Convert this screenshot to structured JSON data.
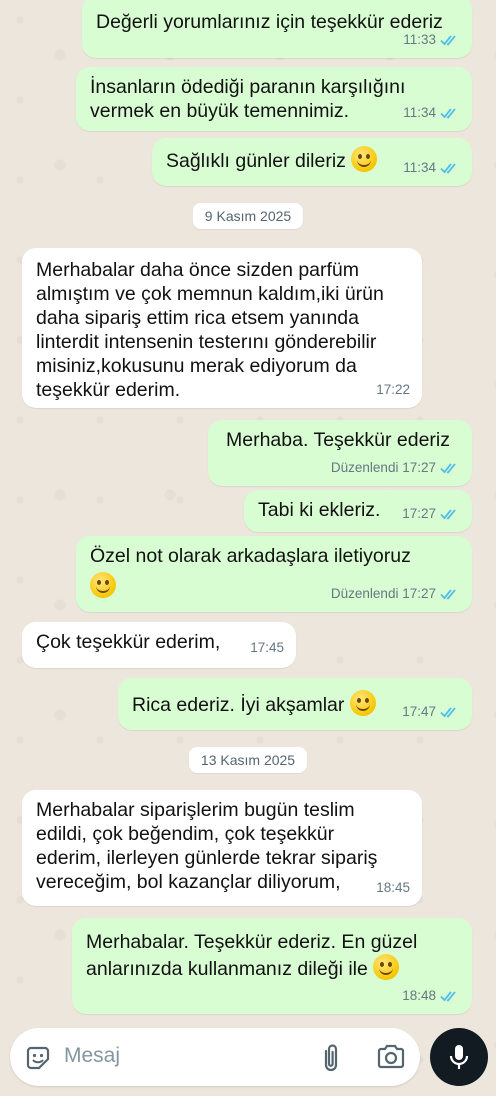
{
  "messages": [
    {
      "text": "Değerli yorumlarınız için teşekkür ederiz",
      "time": "11:33"
    },
    {
      "text": "İnsanların ödediği paranın karşılığını\nvermek en büyük temennimiz.",
      "time": "11:34"
    },
    {
      "text": "Sağlıklı günler dileriz",
      "time": "11:34"
    },
    {
      "text": "Merhabalar daha önce sizden parfüm\nalmıştım ve çok memnun kaldım,iki ürün\ndaha sipariş ettim rica etsem yanında\nlinterdit intensenin testerını gönderebilir\nmisiniz,kokusunu merak ediyorum da\nteşekkür ederim.",
      "time": "17:22"
    },
    {
      "text": "Merhaba. Teşekkür ederiz",
      "time": "Düzenlendi 17:27"
    },
    {
      "text": "Tabi ki ekleriz.",
      "time": "17:27"
    },
    {
      "text": "Özel not olarak arkadaşlara iletiyoruz",
      "time": "Düzenlendi 17:27"
    },
    {
      "text": "Çok teşekkür ederim,",
      "time": "17:45"
    },
    {
      "text": "Rica ederiz. İyi akşamlar",
      "time": "17:47"
    },
    {
      "text": "Merhabalar siparişlerim bugün teslim\nedildi, çok beğendim, çok teşekkür\nederim, ilerleyen günlerde tekrar sipariş\nvereceğim, bol kazançlar diliyorum,",
      "time": "18:45"
    },
    {
      "text": "Merhabalar. Teşekkür ederiz. En güzel\nanlarınızda kullanmanız dileği ile",
      "time": "18:48"
    }
  ],
  "dates": [
    "9 Kasım 2025",
    "13 Kasım 2025"
  ],
  "input": {
    "placeholder": "Mesaj"
  },
  "icons": {
    "emoji_button": "sticker-smile-icon",
    "attach": "paperclip-icon",
    "camera": "camera-icon",
    "mic": "microphone-icon",
    "read_receipt": "double-check-icon",
    "emoji": "slightly-smiling-face"
  },
  "colors": {
    "outgoing_bubble": "#d9fdd3",
    "incoming_bubble": "#ffffff",
    "read_tick": "#53bdeb",
    "mic_button": "#111b21"
  }
}
